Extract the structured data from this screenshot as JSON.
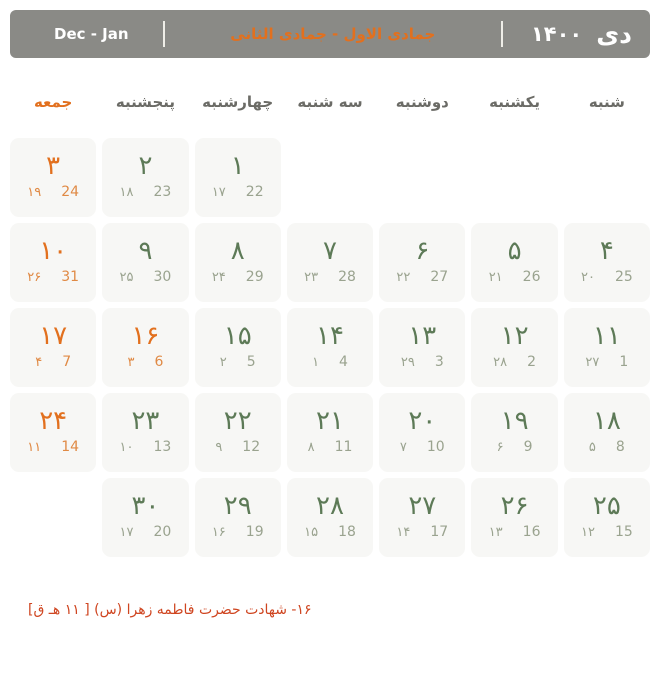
{
  "header": {
    "persian_month": "دی",
    "persian_year": "۱۴۰۰",
    "arabic_months": "جمادی الاول - جمادی الثانی",
    "gregorian_months": "Dec - Jan"
  },
  "colors": {
    "header_bg": "#8a8a86",
    "holiday": "#e2701e",
    "day_number": "#5d7a57",
    "sub_number": "#9aa38f",
    "cell_bg": "#f7f7f5",
    "footnote": "#cf4520"
  },
  "weekdays": [
    {
      "label": "شنبه",
      "holiday": false
    },
    {
      "label": "یکشنبه",
      "holiday": false
    },
    {
      "label": "دوشنبه",
      "holiday": false
    },
    {
      "label": "سه شنبه",
      "holiday": false
    },
    {
      "label": "چهارشنبه",
      "holiday": false
    },
    {
      "label": "پنجشنبه",
      "holiday": false
    },
    {
      "label": "جمعه",
      "holiday": true
    }
  ],
  "weeks": [
    [
      {
        "empty": true
      },
      {
        "empty": true
      },
      {
        "empty": true
      },
      {
        "empty": true
      },
      {
        "day": "۱",
        "hijri": "۱۷",
        "greg": "22",
        "holiday": false
      },
      {
        "day": "۲",
        "hijri": "۱۸",
        "greg": "23",
        "holiday": false
      },
      {
        "day": "۳",
        "hijri": "۱۹",
        "greg": "24",
        "holiday": true
      }
    ],
    [
      {
        "day": "۴",
        "hijri": "۲۰",
        "greg": "25",
        "holiday": false
      },
      {
        "day": "۵",
        "hijri": "۲۱",
        "greg": "26",
        "holiday": false
      },
      {
        "day": "۶",
        "hijri": "۲۲",
        "greg": "27",
        "holiday": false
      },
      {
        "day": "۷",
        "hijri": "۲۳",
        "greg": "28",
        "holiday": false
      },
      {
        "day": "۸",
        "hijri": "۲۴",
        "greg": "29",
        "holiday": false
      },
      {
        "day": "۹",
        "hijri": "۲۵",
        "greg": "30",
        "holiday": false
      },
      {
        "day": "۱۰",
        "hijri": "۲۶",
        "greg": "31",
        "holiday": true
      }
    ],
    [
      {
        "day": "۱۱",
        "hijri": "۲۷",
        "greg": "1",
        "holiday": false
      },
      {
        "day": "۱۲",
        "hijri": "۲۸",
        "greg": "2",
        "holiday": false
      },
      {
        "day": "۱۳",
        "hijri": "۲۹",
        "greg": "3",
        "holiday": false
      },
      {
        "day": "۱۴",
        "hijri": "۱",
        "greg": "4",
        "holiday": false
      },
      {
        "day": "۱۵",
        "hijri": "۲",
        "greg": "5",
        "holiday": false
      },
      {
        "day": "۱۶",
        "hijri": "۳",
        "greg": "6",
        "holiday": true
      },
      {
        "day": "۱۷",
        "hijri": "۴",
        "greg": "7",
        "holiday": true
      }
    ],
    [
      {
        "day": "۱۸",
        "hijri": "۵",
        "greg": "8",
        "holiday": false
      },
      {
        "day": "۱۹",
        "hijri": "۶",
        "greg": "9",
        "holiday": false
      },
      {
        "day": "۲۰",
        "hijri": "۷",
        "greg": "10",
        "holiday": false
      },
      {
        "day": "۲۱",
        "hijri": "۸",
        "greg": "11",
        "holiday": false
      },
      {
        "day": "۲۲",
        "hijri": "۹",
        "greg": "12",
        "holiday": false
      },
      {
        "day": "۲۳",
        "hijri": "۱۰",
        "greg": "13",
        "holiday": false
      },
      {
        "day": "۲۴",
        "hijri": "۱۱",
        "greg": "14",
        "holiday": true
      }
    ],
    [
      {
        "day": "۲۵",
        "hijri": "۱۲",
        "greg": "15",
        "holiday": false
      },
      {
        "day": "۲۶",
        "hijri": "۱۳",
        "greg": "16",
        "holiday": false
      },
      {
        "day": "۲۷",
        "hijri": "۱۴",
        "greg": "17",
        "holiday": false
      },
      {
        "day": "۲۸",
        "hijri": "۱۵",
        "greg": "18",
        "holiday": false
      },
      {
        "day": "۲۹",
        "hijri": "۱۶",
        "greg": "19",
        "holiday": false
      },
      {
        "day": "۳۰",
        "hijri": "۱۷",
        "greg": "20",
        "holiday": false
      },
      {
        "empty": true
      }
    ]
  ],
  "footnotes": [
    "۱۶- شهادت حضرت فاطمه زهرا (س) [ ۱۱ هـ ق]"
  ]
}
